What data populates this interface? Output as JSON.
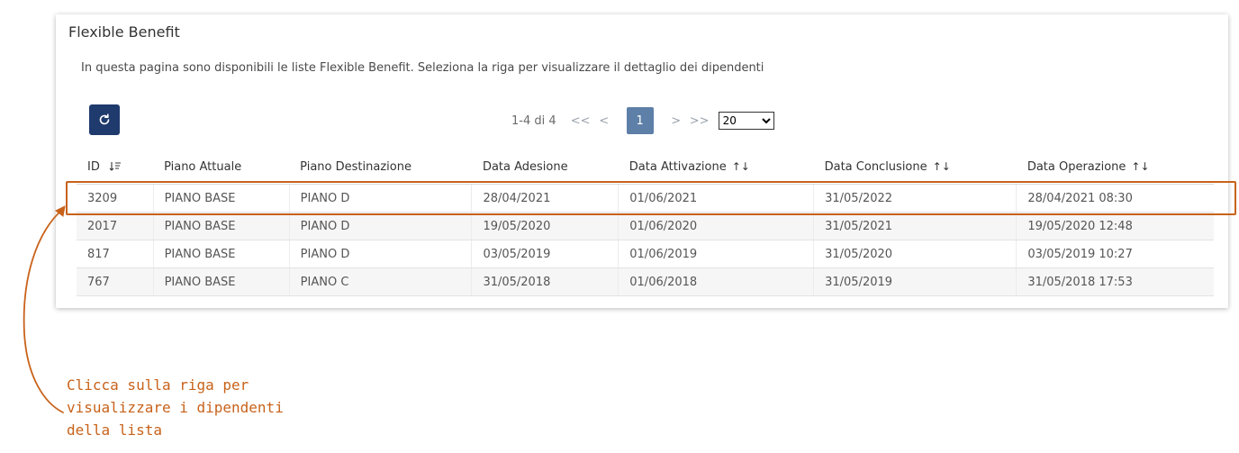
{
  "card": {
    "title": "Flexible Benefit",
    "description": "In questa pagina sono disponibili le liste Flexible Benefit. Seleziona la riga per visualizzare il dettaglio dei dipendenti"
  },
  "toolbar": {
    "refresh_icon": "refresh-icon"
  },
  "pager": {
    "range": "1-4 di 4",
    "first": "<<",
    "prev": "<",
    "current": "1",
    "next": ">",
    "last": ">>",
    "page_size": "20",
    "page_size_options": [
      "20"
    ]
  },
  "table": {
    "columns": [
      {
        "label": "ID",
        "sort": "sort-desc-icon"
      },
      {
        "label": "Piano Attuale"
      },
      {
        "label": "Piano Destinazione"
      },
      {
        "label": "Data Adesione"
      },
      {
        "label": "Data Attivazione",
        "sort": "sort-both-icon"
      },
      {
        "label": "Data Conclusione",
        "sort": "sort-both-icon"
      },
      {
        "label": "Data Operazione",
        "sort": "sort-both-icon"
      }
    ],
    "rows": [
      [
        "3209",
        "PIANO BASE",
        "PIANO D",
        "28/04/2021",
        "01/06/2021",
        "31/05/2022",
        "28/04/2021 08:30"
      ],
      [
        "2017",
        "PIANO BASE",
        "PIANO D",
        "19/05/2020",
        "01/06/2020",
        "31/05/2021",
        "19/05/2020 12:48"
      ],
      [
        "817",
        "PIANO BASE",
        "PIANO D",
        "03/05/2019",
        "01/06/2019",
        "31/05/2020",
        "03/05/2019 10:27"
      ],
      [
        "767",
        "PIANO BASE",
        "PIANO C",
        "31/05/2018",
        "01/06/2018",
        "31/05/2019",
        "31/05/2018 17:53"
      ]
    ]
  },
  "annotation": {
    "line1": "Clicca sulla riga per",
    "line2": "visualizzare i dipendenti",
    "line3": "della lista",
    "color": "#c8621a"
  },
  "colors": {
    "primary_button": "#1f3a6d",
    "current_page": "#5d7fa8"
  }
}
